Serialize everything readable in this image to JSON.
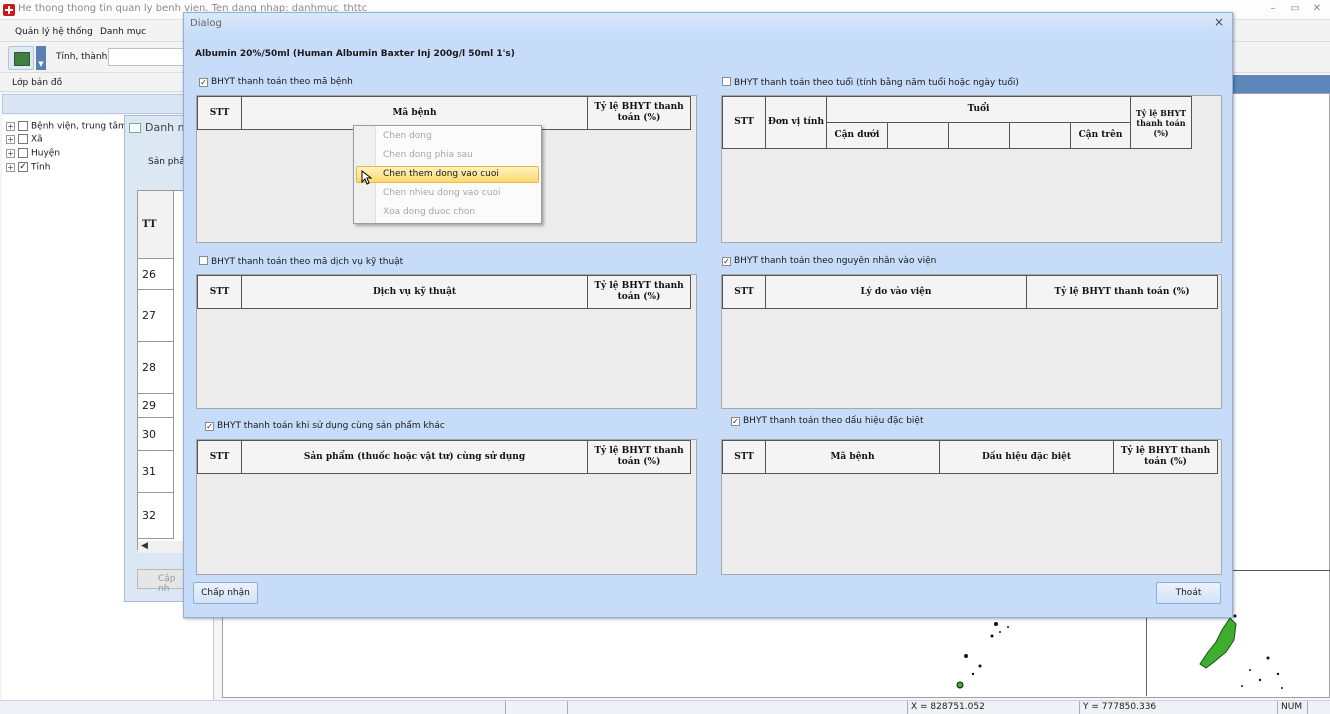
{
  "app": {
    "title": "He thong thong tin quan ly benh vien. Ten dang nhap: danhmuc_thttc",
    "minimize": "–",
    "maximize": "▭",
    "close": "✕"
  },
  "menu": [
    "Quản lý hệ thống",
    "Danh mục"
  ],
  "toolbar": {
    "province_label": "Tỉnh, thành:",
    "province_value": ""
  },
  "layer_label": "Lớp bản đồ",
  "tree": [
    {
      "label": "Bệnh viện, trung tâm",
      "checked": false
    },
    {
      "label": "Xã",
      "checked": false
    },
    {
      "label": "Huyện",
      "checked": false
    },
    {
      "label": "Tỉnh",
      "checked": true
    }
  ],
  "bg_dialog": {
    "title": "Danh m",
    "label": "Sản phẩm",
    "header": "TT",
    "rows": [
      "26",
      "27",
      "28",
      "29",
      "30",
      "31",
      "32"
    ],
    "button": "Cập nh"
  },
  "status": {
    "x": "X = 828751.052",
    "y": "Y = 777850.336",
    "num": "NUM"
  },
  "dialog": {
    "title": "Dialog",
    "close": "×",
    "product": "Albumin 20%/50ml (Human Albumin Baxter Inj 200g/l 50ml 1's)",
    "ok_label": "Chấp nhận",
    "exit_label": "Thoát",
    "sections": {
      "disease": {
        "label": "BHYT thanh toán theo mã bệnh",
        "checked": true,
        "cols": [
          "STT",
          "Mã bệnh",
          "Tỷ lệ BHYT thanh toán (%)"
        ]
      },
      "service": {
        "label": "BHYT thanh toán theo mã dịch vụ kỹ thuật",
        "checked": false,
        "cols": [
          "STT",
          "Dịch vụ kỹ thuật",
          "Tỷ lệ BHYT thanh toán (%)"
        ]
      },
      "combo": {
        "label": "BHYT thanh toán khi sử dụng cùng sản phẩm khác",
        "checked": true,
        "cols": [
          "STT",
          "Sản phẩm (thuốc hoặc vật tư) cùng sử dụng",
          "Tỷ lệ BHYT thanh toán (%)"
        ]
      },
      "age": {
        "label": "BHYT thanh toán theo tuổi (tính bằng năm tuổi hoặc ngày tuổi)",
        "checked": false,
        "cols": [
          "STT",
          "Đơn vị tính",
          "Tuổi",
          "Cận dưới",
          "Cận trên",
          "Tỷ lệ BHYT thanh toán (%)"
        ]
      },
      "reason": {
        "label": "BHYT thanh toán theo nguyên nhân vào viện",
        "checked": true,
        "cols": [
          "STT",
          "Lý do vào viện",
          "Tỷ lệ BHYT thanh toán (%)"
        ]
      },
      "sign": {
        "label": "BHYT thanh toán theo dấu hiệu đặc biệt",
        "checked": true,
        "cols": [
          "STT",
          "Mã bệnh",
          "Dấu hiệu đặc biệt",
          "Tỷ lệ BHYT thanh toán (%)"
        ]
      }
    }
  },
  "context_menu": {
    "items": [
      "Chen dong",
      "Chen dong phia sau",
      "Chen them dong vao cuoi",
      "Chen nhieu dong vao cuoi",
      "Xoa dong duoc chon"
    ],
    "highlighted_index": 2
  }
}
